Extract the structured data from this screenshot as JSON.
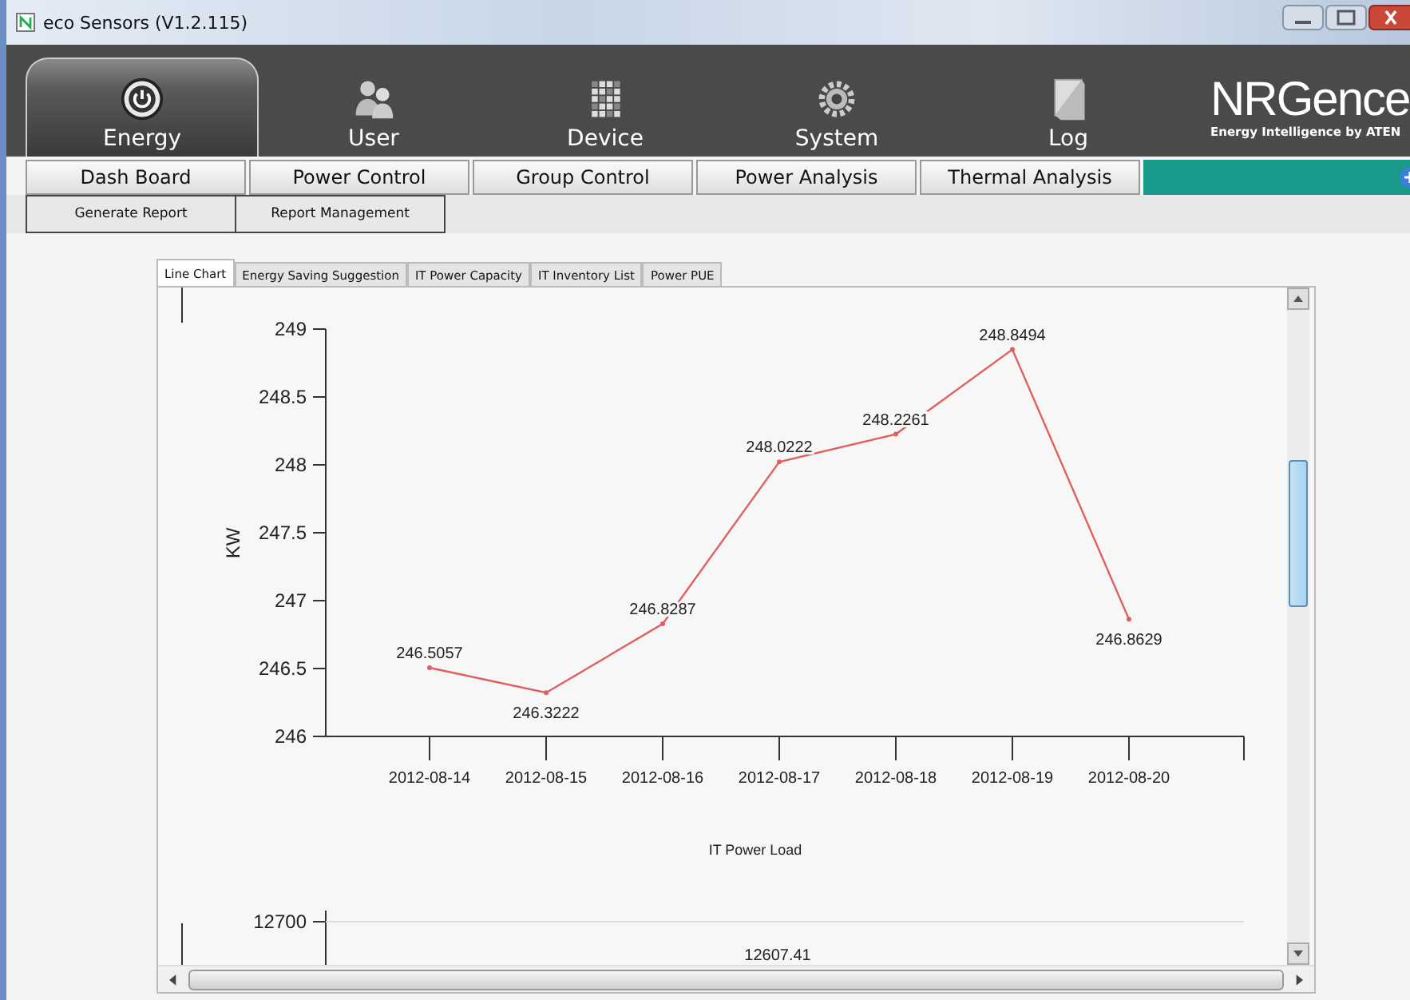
{
  "window": {
    "title": "eco Sensors (V1.2.115)"
  },
  "main_tabs": [
    {
      "label": "Energy",
      "kind": "power",
      "selected": true
    },
    {
      "label": "User",
      "kind": "users",
      "selected": false
    },
    {
      "label": "Device",
      "kind": "grid",
      "selected": false
    },
    {
      "label": "System",
      "kind": "gear",
      "selected": false
    },
    {
      "label": "Log",
      "kind": "document",
      "selected": false
    }
  ],
  "brand": {
    "name": "NRGence",
    "tagline": "Energy Intelligence by ATEN"
  },
  "menu": [
    "Dash Board",
    "Power Control",
    "Group Control",
    "Power Analysis",
    "Thermal Analysis"
  ],
  "submenu": [
    "Generate Report",
    "Report Management"
  ],
  "content_tabs": [
    {
      "label": "Line Chart",
      "selected": true
    },
    {
      "label": "Energy Saving Suggestion",
      "selected": false
    },
    {
      "label": "IT Power Capacity",
      "selected": false
    },
    {
      "label": "IT Inventory List",
      "selected": false
    },
    {
      "label": "Power PUE",
      "selected": false
    }
  ],
  "chart": {
    "chart_data": {
      "type": "line",
      "xlabel": "IT Power Load",
      "ylabel": "KW",
      "categories": [
        "2012-08-14",
        "2012-08-15",
        "2012-08-16",
        "2012-08-17",
        "2012-08-18",
        "2012-08-19",
        "2012-08-20"
      ],
      "series": [
        {
          "color": "#e06060",
          "marker": true,
          "values": [
            246.5057,
            246.3222,
            246.8287,
            248.0222,
            248.2261,
            248.8494,
            246.8629
          ]
        }
      ],
      "ylim": [
        246,
        249
      ],
      "yticks": [
        246,
        246.5,
        247,
        247.5,
        248,
        248.5,
        249
      ],
      "data_labels": true
    }
  },
  "second_chart": {
    "tick": "12700",
    "value_label": "12607.41"
  }
}
